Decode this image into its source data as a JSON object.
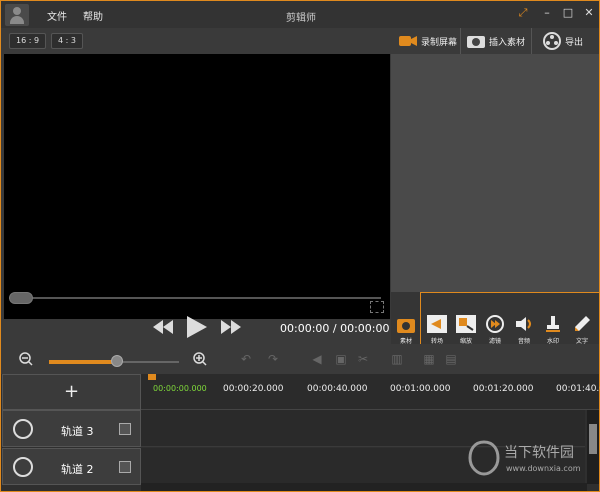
{
  "app": {
    "title": "剪辑师",
    "menu": [
      "文件",
      "帮助"
    ]
  },
  "preview": {
    "ratios": [
      "16 : 9",
      "4 : 3"
    ],
    "time": "00:00:00 / 00:00:00",
    "progress": 0
  },
  "right_bar": {
    "record": "录制屏幕",
    "insert": "插入素材",
    "export": "导出"
  },
  "tools": {
    "assets": "素材",
    "items": [
      "转场",
      "缩放",
      "滤镜",
      "音频",
      "水印",
      "文字"
    ]
  },
  "zoom": {
    "level": 0.52
  },
  "timeline": {
    "add_label": "+",
    "current_time": "00:00:00.000",
    "ticks": [
      "00:00:20.000",
      "00:00:40.000",
      "00:01:00.000",
      "00:01:20.000",
      "00:01:40.0"
    ],
    "tracks": [
      {
        "name": "轨道 3"
      },
      {
        "name": "轨道 2"
      }
    ]
  },
  "watermark": {
    "name": "当下软件园",
    "url": "www.downxia.com"
  },
  "colors": {
    "accent": "#e08a1e",
    "time_green": "#7fd83a"
  }
}
